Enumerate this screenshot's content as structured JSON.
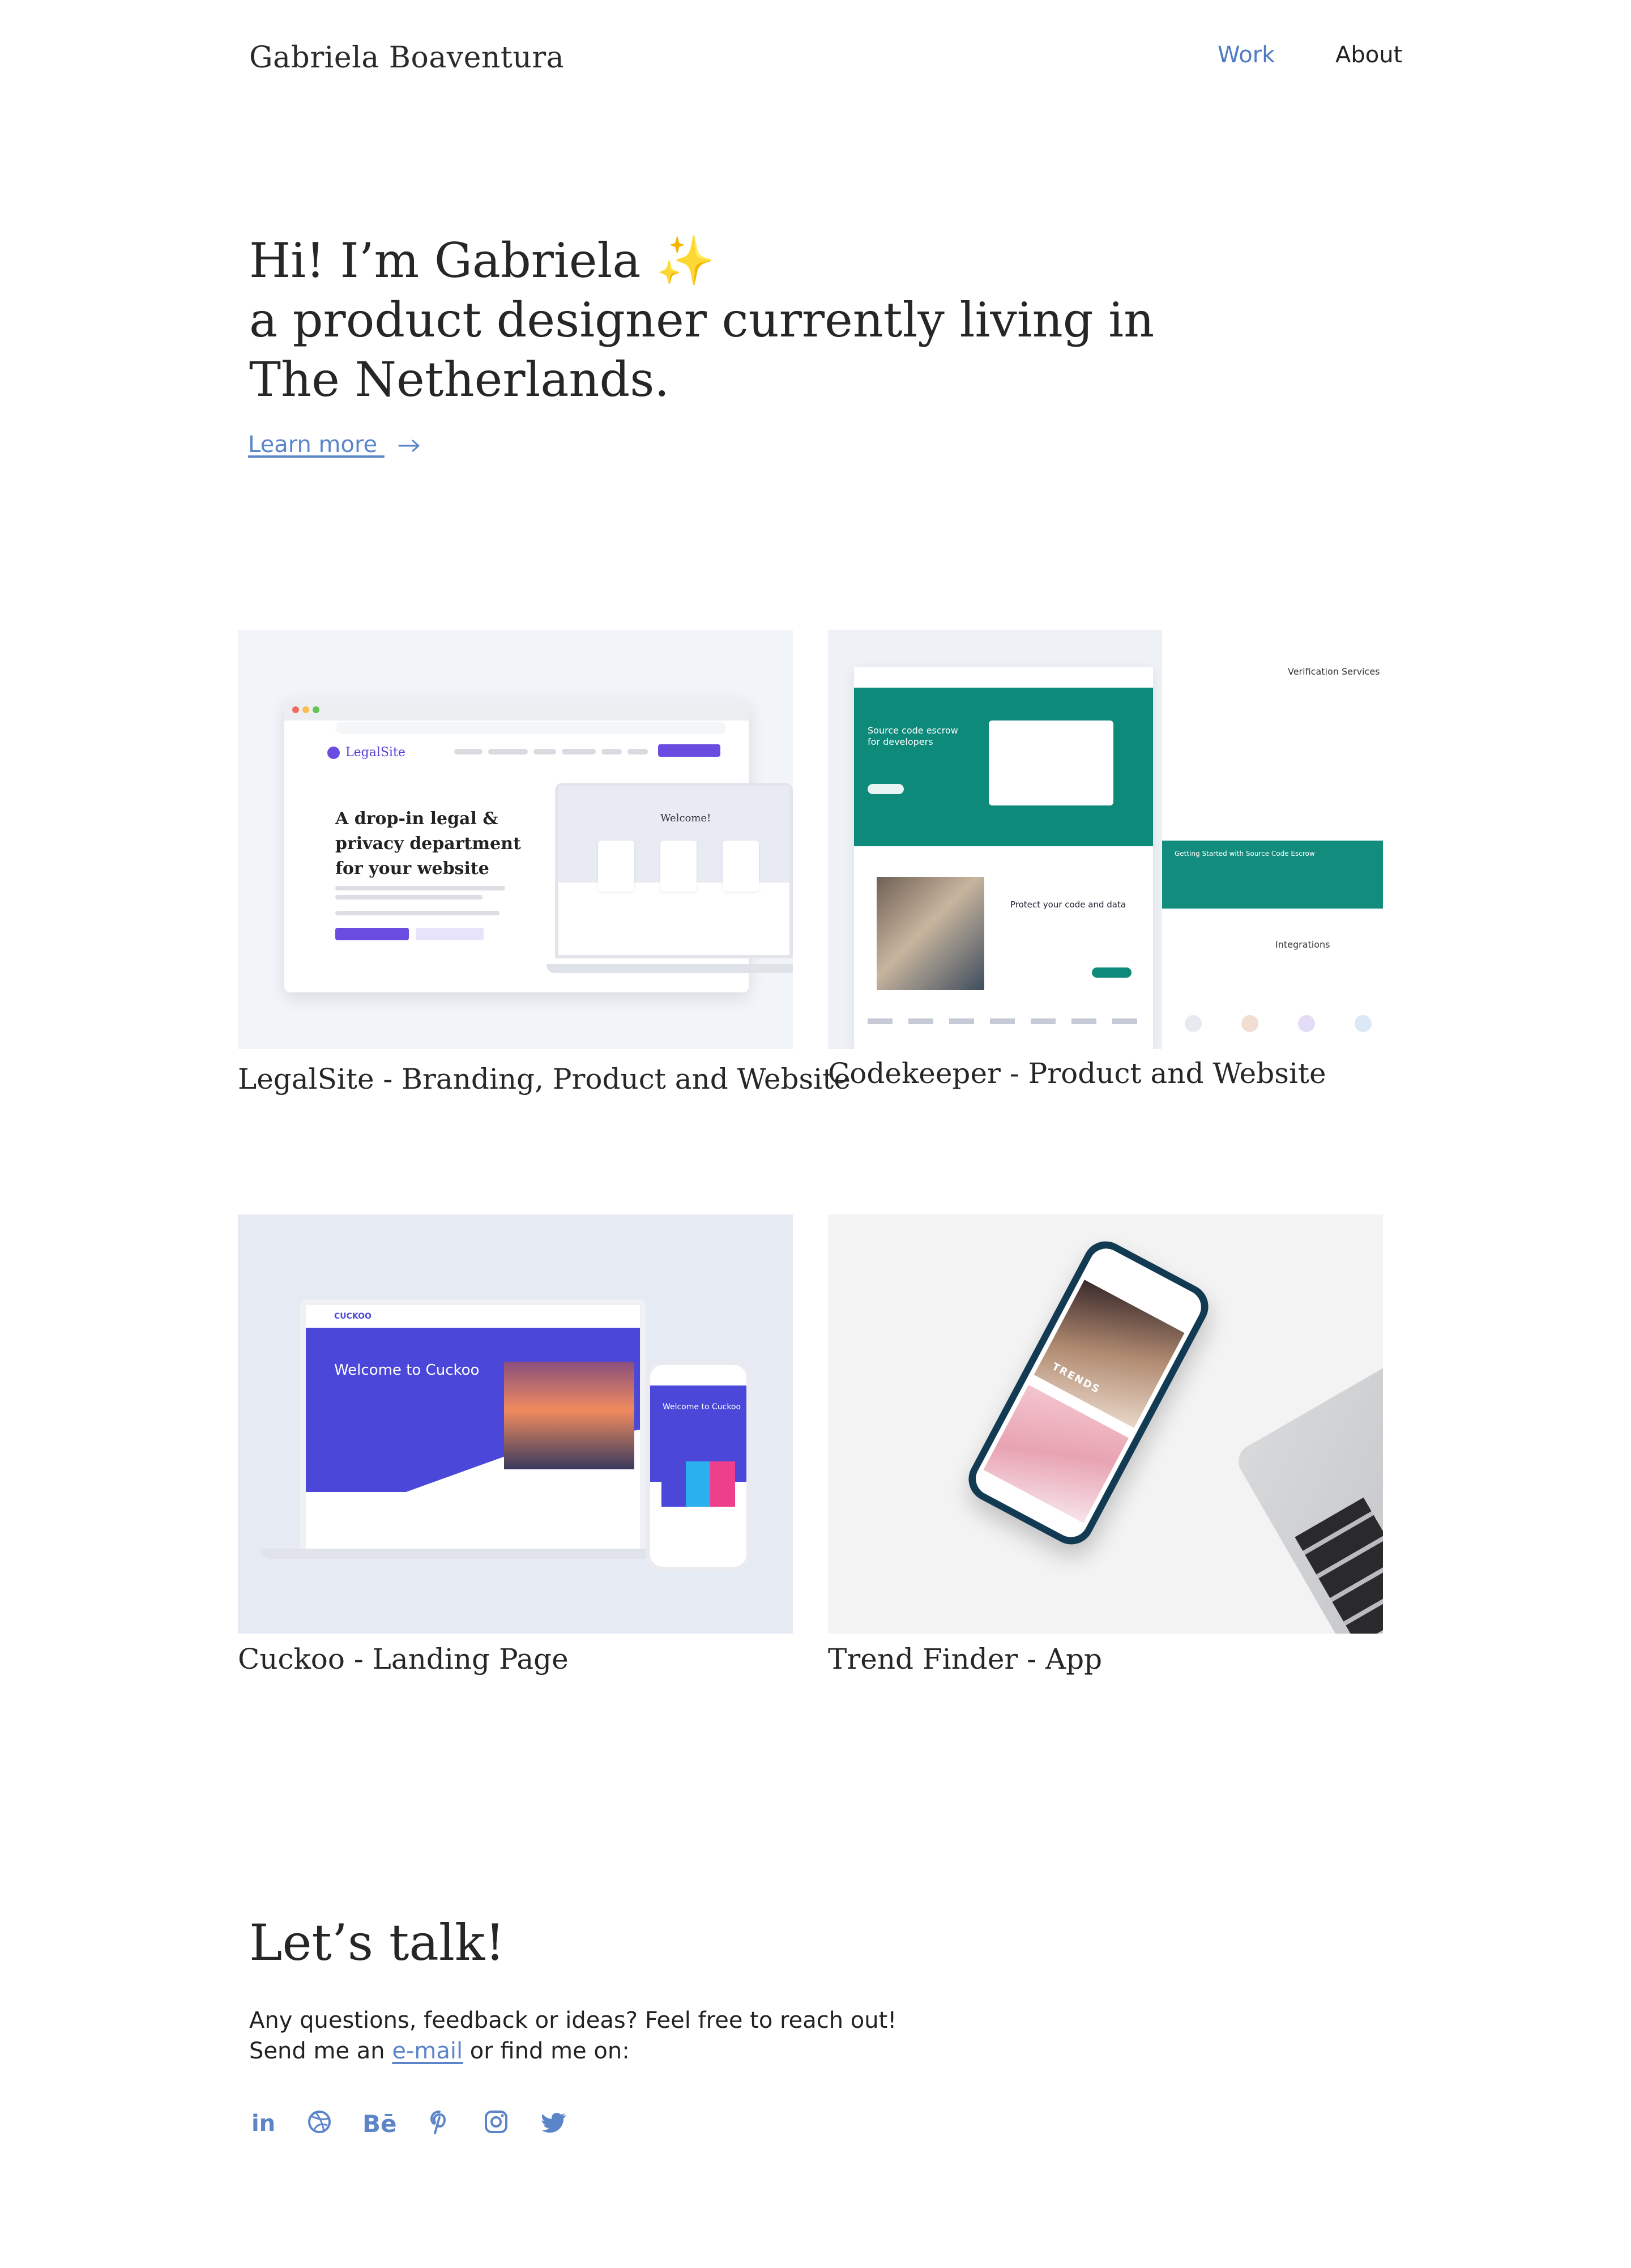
{
  "header": {
    "site_name": "Gabriela Boaventura",
    "nav": [
      {
        "label": "Work",
        "active": true
      },
      {
        "label": "About",
        "active": false
      }
    ]
  },
  "hero": {
    "line1": "Hi! I’m Gabriela ✨",
    "line2": "a product designer currently living in",
    "line3": "The Netherlands.",
    "learn_more": "Learn more"
  },
  "projects": [
    {
      "title": "LegalSite - Branding, Product and Website",
      "preview": {
        "logo": "LegalSite",
        "headline": "A drop-in legal & privacy department for your website",
        "welcome": "Welcome!"
      }
    },
    {
      "title": "Codekeeper - Product and Website",
      "preview": {
        "hero_title": "Source code escrow for developers",
        "protect": "Protect your code and data",
        "verification": "Verification Services",
        "getting_started": "Getting Started with Source Code Escrow",
        "integrations": "Integrations"
      }
    },
    {
      "title": "Cuckoo - Landing Page",
      "preview": {
        "logo": "CUCKOO",
        "welcome": "Welcome to Cuckoo"
      }
    },
    {
      "title": "Trend Finder - App",
      "preview": {
        "label": "TRENDS"
      }
    }
  ],
  "contact": {
    "title": "Let’s talk!",
    "line1": "Any questions, feedback or ideas? Feel free to reach out!",
    "line2_prefix": "Send me an ",
    "email_link": "e-mail",
    "line2_suffix": " or find me on:",
    "social": [
      {
        "name": "linkedin-icon",
        "glyph": "in"
      },
      {
        "name": "dribbble-icon",
        "glyph": ""
      },
      {
        "name": "behance-icon",
        "glyph": "Bē"
      },
      {
        "name": "pinterest-icon",
        "glyph": ""
      },
      {
        "name": "instagram-icon",
        "glyph": ""
      },
      {
        "name": "twitter-icon",
        "glyph": ""
      }
    ]
  },
  "colors": {
    "accent": "#5b85c8",
    "legal_purple": "#6a4de0",
    "codekeeper_teal": "#0e8a7a",
    "cuckoo_blue": "#4a47d9"
  }
}
